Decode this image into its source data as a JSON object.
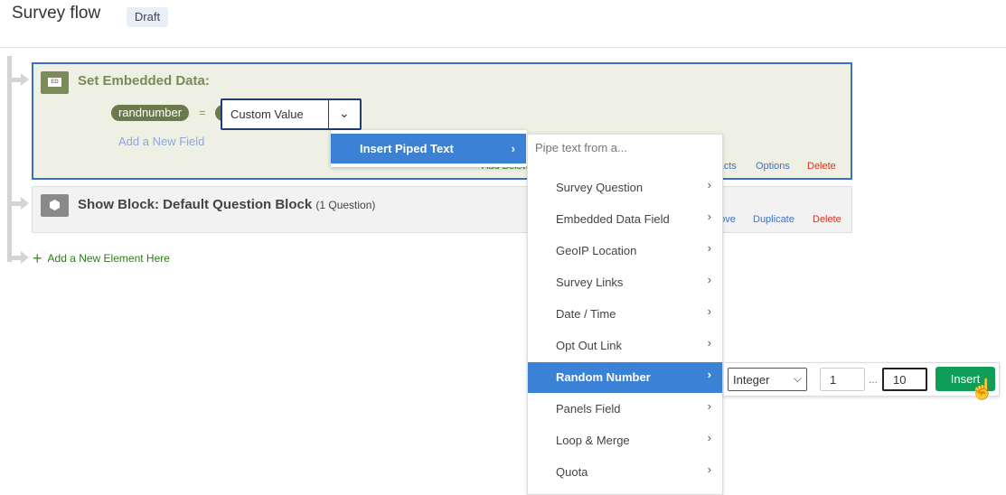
{
  "header": {
    "title": "Survey flow",
    "status": "Draft"
  },
  "embedded_block": {
    "title": "Set Embedded Data:",
    "icon_label": "ED",
    "field_name": "randnumber",
    "equals": "=",
    "value_type": "Custom Value",
    "add_field": "Add a New Field",
    "links": {
      "add_below": "Add Below",
      "contacts": "Add From Contacts",
      "options": "Options",
      "delete": "Delete"
    }
  },
  "show_block": {
    "title": "Show Block: Default Question Block",
    "count": "(1 Question)",
    "links": {
      "move": "Move",
      "duplicate": "Duplicate",
      "delete": "Delete"
    }
  },
  "add_element": "Add a New Element Here",
  "menu": {
    "insert_piped_text": "Insert Piped Text",
    "pipe_header": "Pipe text from a...",
    "items": [
      "Survey Question",
      "Embedded Data Field",
      "GeoIP Location",
      "Survey Links",
      "Date / Time",
      "Opt Out Link",
      "Random Number",
      "Panels Field",
      "Loop & Merge",
      "Quota"
    ],
    "selected": "Random Number"
  },
  "random": {
    "type": "Integer",
    "min": "1",
    "range_sep": "...",
    "max": "10",
    "insert": "Insert"
  },
  "colors": {
    "accent": "#3b82d6",
    "embedded": "#7c8b5a",
    "insert": "#0f9d58",
    "delete": "#e0301e"
  }
}
